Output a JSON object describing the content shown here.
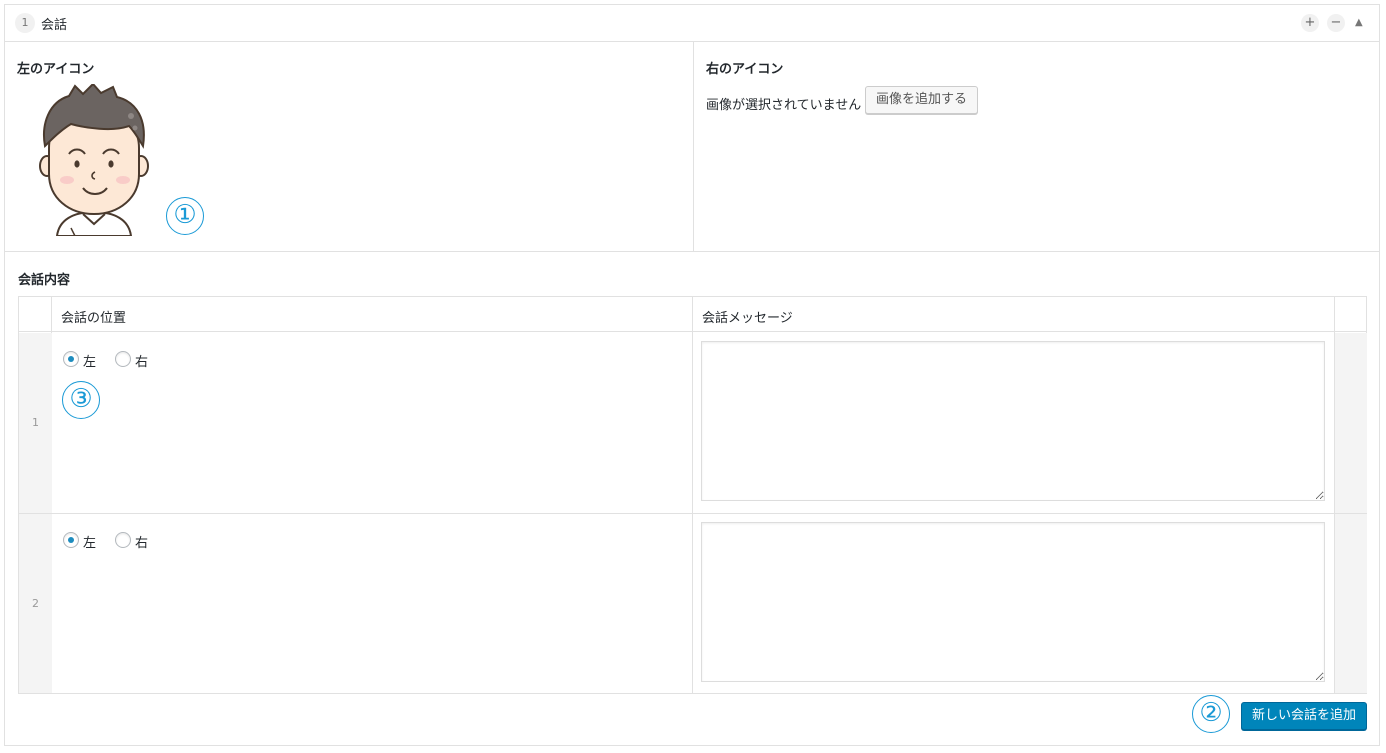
{
  "header": {
    "row_index": "1",
    "title": "会話",
    "add_icon": "plus-icon",
    "remove_icon": "minus-icon",
    "collapse_icon": "triangle-up-icon"
  },
  "left_icon": {
    "label": "左のアイコン",
    "image": "avatar-man-illustration",
    "callout": "①"
  },
  "right_icon": {
    "label": "右のアイコン",
    "no_image_text": "画像が選択されていません",
    "add_button": "画像を追加する"
  },
  "conversation": {
    "label": "会話内容",
    "columns": [
      "会話の位置",
      "会話メッセージ"
    ],
    "rows": [
      {
        "index": "1",
        "left_label": "左",
        "right_label": "右",
        "selected": "左",
        "message": ""
      },
      {
        "index": "2",
        "left_label": "左",
        "right_label": "右",
        "selected": "左",
        "message": ""
      }
    ],
    "position_callout": "③"
  },
  "footer": {
    "add_callout": "②",
    "add_button": "新しい会話を追加"
  },
  "colors": {
    "primary": "#0085ba",
    "callout": "#1a9ad6",
    "border": "#e1e1e1",
    "index_bg": "#f4f4f4"
  }
}
